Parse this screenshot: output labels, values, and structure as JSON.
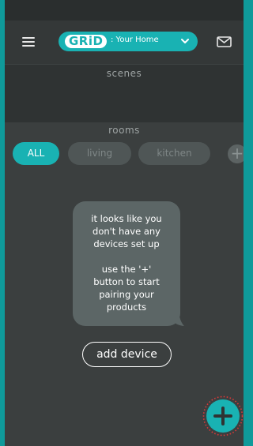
{
  "header": {
    "logo_text": "GRiD",
    "home_label": ": Your Home",
    "icons": [
      "hamburger-menu-icon",
      "chevron-down-icon",
      "mail-icon"
    ]
  },
  "scenes": {
    "title": "scenes"
  },
  "rooms": {
    "title": "rooms",
    "filters": [
      {
        "label": "ALL",
        "active": true
      },
      {
        "label": "living",
        "active": false
      },
      {
        "label": "kitchen",
        "active": false
      }
    ],
    "add_room_symbol": "+"
  },
  "empty_state": {
    "line1": "it looks like you",
    "line2": "don't have any",
    "line3": "devices set up",
    "line4": "use the '+'",
    "line5": "button to start",
    "line6": "pairing your",
    "line7": "products"
  },
  "add_device_label": "add device",
  "colors": {
    "accent": "#19b2b3",
    "background": "#2f3333",
    "fab_ring": "#d83a3a"
  }
}
